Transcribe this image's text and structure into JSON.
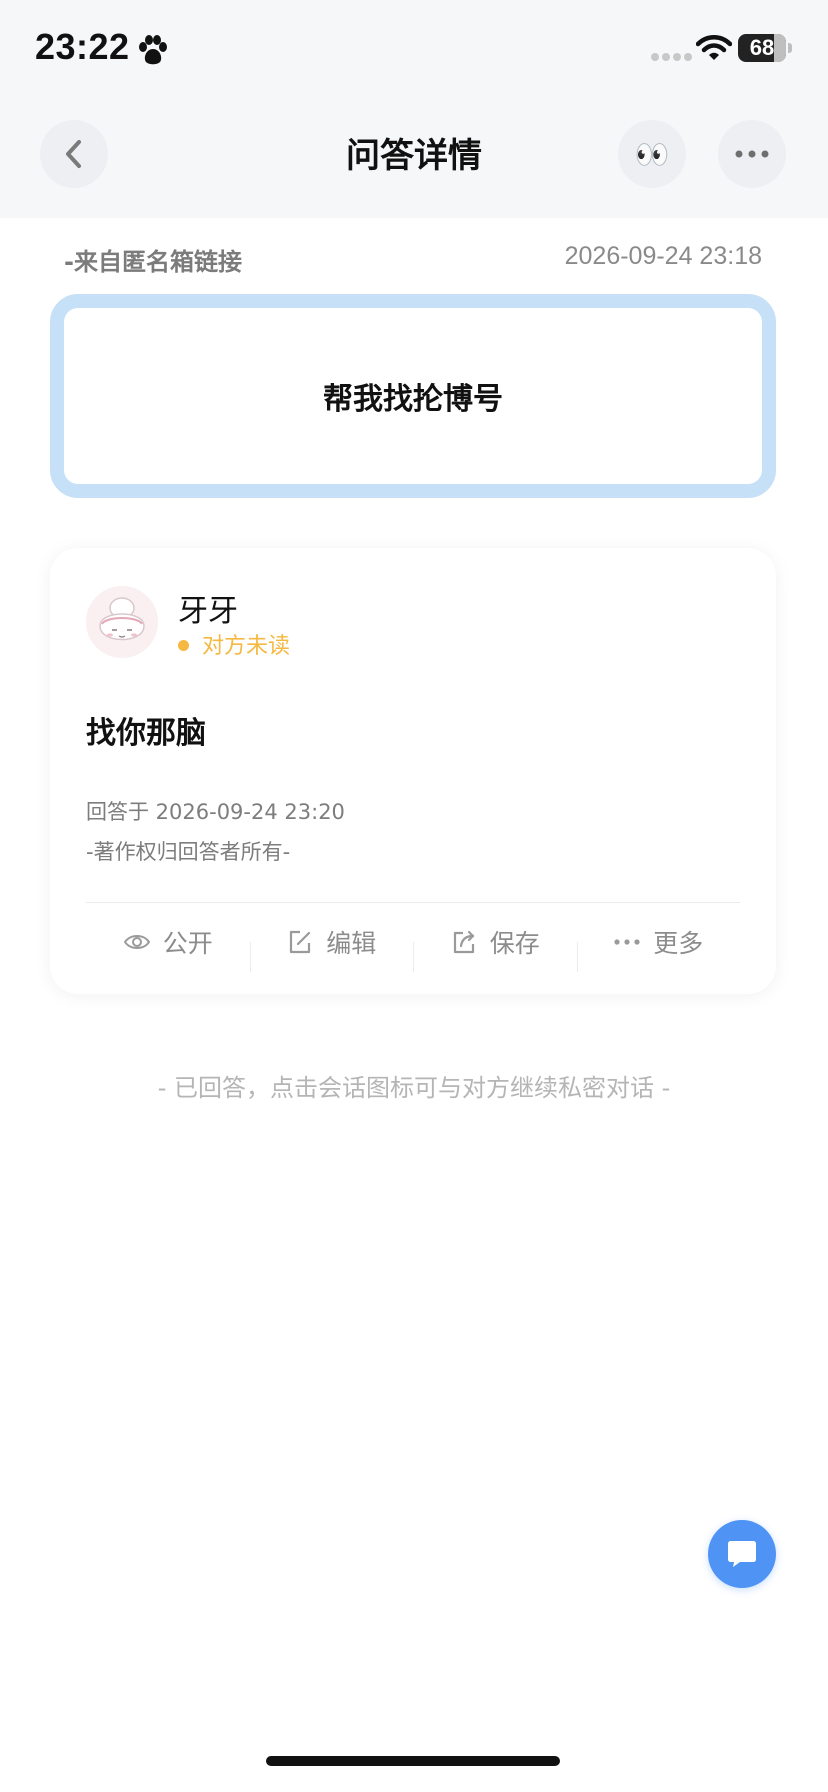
{
  "status_bar": {
    "time": "23:22",
    "battery": "68"
  },
  "header": {
    "title": "问答详情",
    "eyes_emoji": "👀"
  },
  "question": {
    "source": "-来自匿名箱链接",
    "time": "2026-09-24 23:18",
    "text": "帮我找抡博号"
  },
  "answer": {
    "user_name": "牙牙",
    "read_status": "对方未读",
    "text": "找你那脑",
    "answered_at": "回答于 2026-09-24 23:20",
    "copyright": "-著作权归回答者所有-",
    "actions": {
      "public": "公开",
      "edit": "编辑",
      "save": "保存",
      "more": "更多"
    }
  },
  "hint": "- 已回答，点击会话图标可与对方继续私密对话 -",
  "colors": {
    "accent": "#4f94f5",
    "question_border": "#c6e0f8",
    "unread": "#f5b942"
  }
}
